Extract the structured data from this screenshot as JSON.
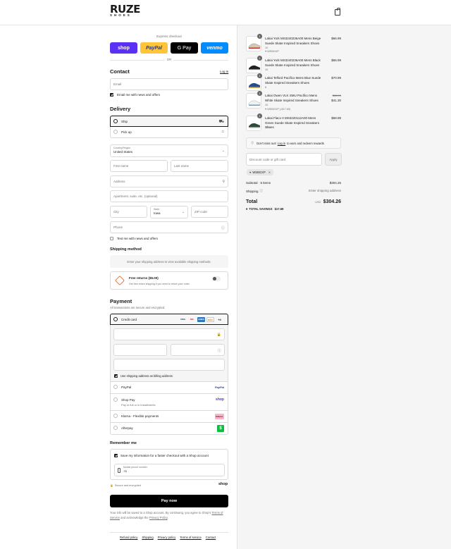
{
  "brand": {
    "line1": "RUZE",
    "line2": "SHOES"
  },
  "express": {
    "title": "Express checkout",
    "buttons": [
      {
        "label": "shop",
        "bg": "#5a31f4",
        "fg": "#ffffff"
      },
      {
        "label": "PayPal",
        "bg": "#ffc439",
        "fg": "#253b80"
      },
      {
        "label": "G Pay",
        "bg": "#000000",
        "fg": "#ffffff"
      },
      {
        "label": "venmo",
        "bg": "#008cff",
        "fg": "#ffffff"
      }
    ],
    "or": "OR"
  },
  "contact": {
    "title": "Contact",
    "login": "Log in",
    "email_placeholder": "Email",
    "news_label": "Email me with news and offers"
  },
  "delivery": {
    "title": "Delivery",
    "ship": "Ship",
    "pickup": "Pick up",
    "country_label": "Country/Region",
    "country_value": "United States",
    "first_name": "First name",
    "last_name": "Last name",
    "address": "Address",
    "apartment": "Apartment, suite, etc. (optional)",
    "city": "City",
    "state_label": "State",
    "state_value": "Iowa",
    "zip": "ZIP code",
    "phone": "Phone",
    "text_label": "Text me with news and offers"
  },
  "shipping": {
    "title": "Shipping method",
    "notice": "Enter your shipping address to view available shipping methods.",
    "returns_title": "Free returns ($5.00)",
    "returns_sub": "Get free return shipping if you need to return your order."
  },
  "payment": {
    "title": "Payment",
    "subtitle": "All transactions are secure and encrypted.",
    "credit": "Credit card",
    "card_logos": [
      "VISA",
      "MC",
      "AMEX",
      "DISC",
      "+4"
    ],
    "billing_label": "Use shipping address as billing address",
    "options": [
      {
        "label": "PayPal",
        "sub": "",
        "logo": "PayPal"
      },
      {
        "label": "Shop Pay",
        "sub": "Pay in full or in installments",
        "logo": "shop"
      },
      {
        "label": "Klarna - Flexible payments",
        "sub": "",
        "logo": "Klarna."
      },
      {
        "label": "Afterpay",
        "sub": "",
        "logo": "$"
      }
    ]
  },
  "remember": {
    "title": "Remember me",
    "save_label": "Save my information for a faster checkout with a Shop account",
    "mobile_label": "Mobile phone number",
    "mobile_value": "+1",
    "secure": "Secure and encrypted",
    "shop": "shop"
  },
  "pay_button": "Pay now",
  "legal": {
    "text1": "Your info will be saved to a Shop account. By continuing, you agree to Shop's",
    "terms": "Terms of Service",
    "text2": "and acknowledge the",
    "privacy": "Privacy Policy",
    "end": "."
  },
  "footer_links": [
    "Refund policy",
    "Shipping",
    "Privacy policy",
    "Terms of service",
    "Contact"
  ],
  "cart": {
    "items": [
      {
        "qty": "1",
        "name": "Lakai York MS3240236A00 Mens Beige Suede Skate Inspired Sneakers Shoes",
        "size": "10",
        "discount": "WSBGXP",
        "price": "$66.99",
        "orig": ""
      },
      {
        "qty": "1",
        "name": "Lakai York MS3240236A00 Mens Black Suede Skate Inspired Sneakers Shoes",
        "size": "10",
        "discount": "",
        "price": "$65.99",
        "orig": ""
      },
      {
        "qty": "1",
        "name": "Lakai Telford Pacifico Mens Blue Suede Skate Inspired Sneakers Shoes",
        "size": "8",
        "discount": "",
        "price": "$70.99",
        "orig": ""
      },
      {
        "qty": "1",
        "name": "Lakai Owen VLK SMU Pacifico Mens White Skate Inspired Sneakers Shoes",
        "size": "10",
        "discount": "WSBGXP (-$17.69)",
        "price": "$41.30",
        "orig": "$58.99"
      },
      {
        "qty": "1",
        "name": "Lakai Flaco II MS3220112A00 Mens Green Suede Skate Inspired Sneakers Shoes",
        "size": "10.5",
        "discount": "",
        "price": "$58.99",
        "orig": ""
      }
    ],
    "rewards_pre": "Don't miss out!",
    "rewards_link": "Log in",
    "rewards_post": "to earn and redeem rewards",
    "code_placeholder": "Discount code or gift card",
    "apply": "Apply",
    "tag": "WSBGXP",
    "subtotal_label": "Subtotal · 5 items",
    "subtotal": "$304.26",
    "shipping_label": "Shipping",
    "shipping_value": "Enter shipping address",
    "total_label": "Total",
    "currency": "USD",
    "total": "$304.26",
    "savings_label": "TOTAL SAVINGS",
    "savings": "$17.69"
  }
}
